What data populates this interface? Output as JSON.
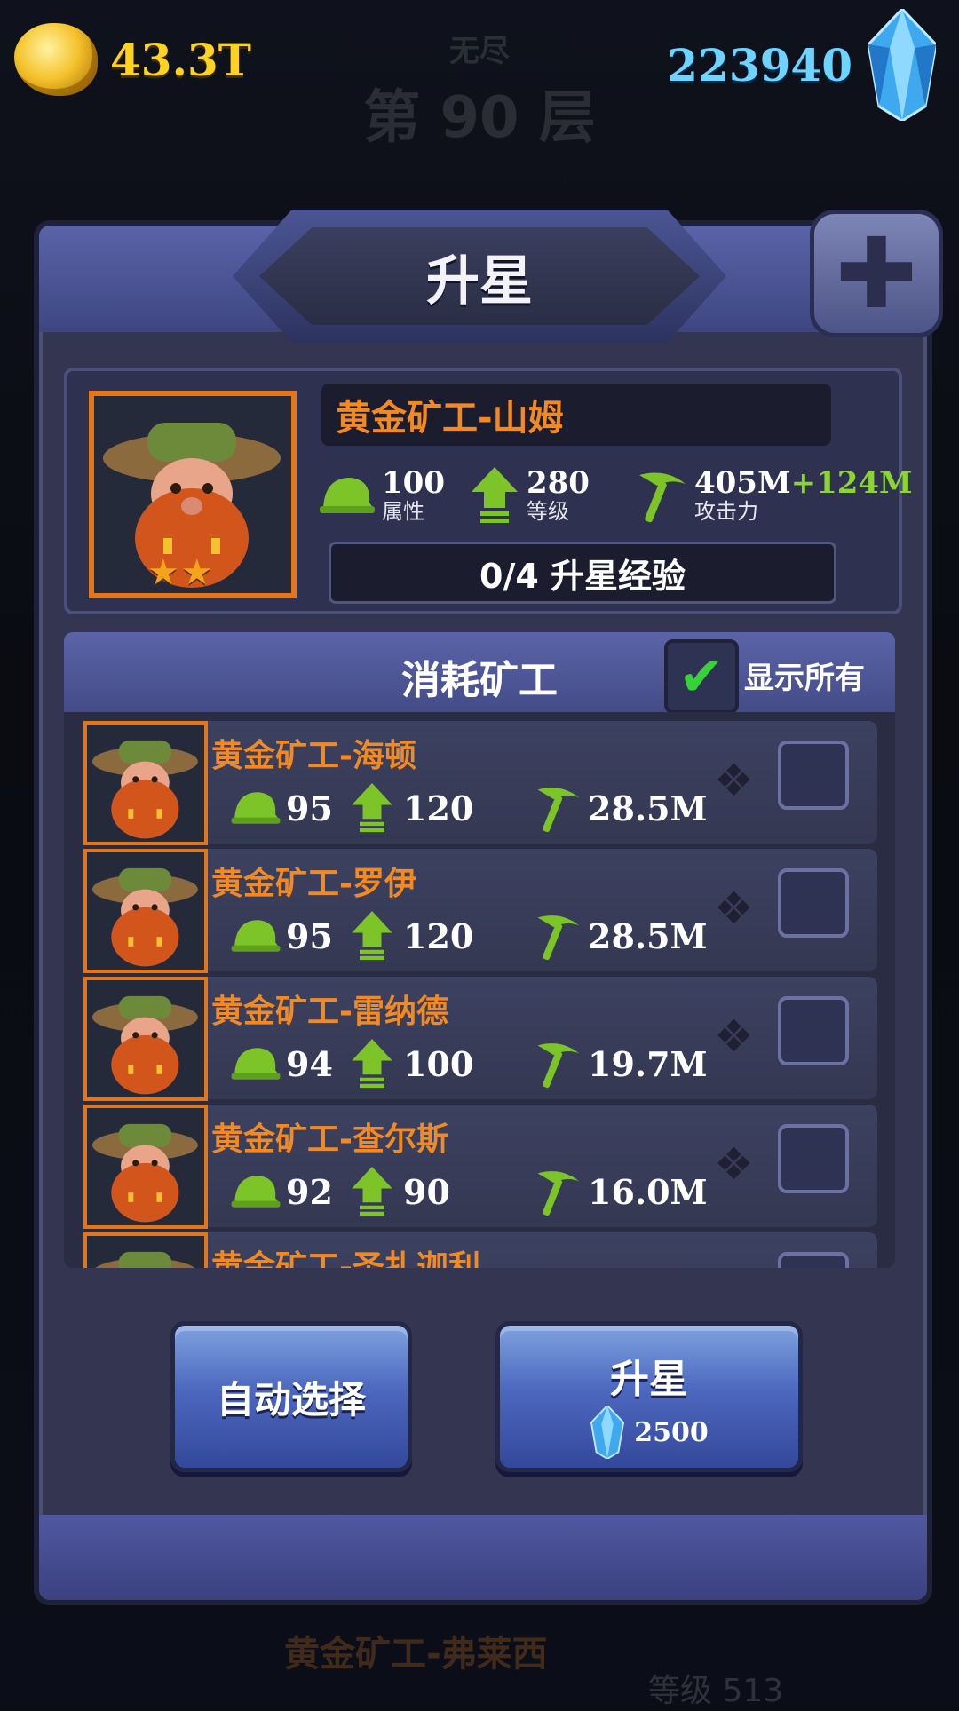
{
  "background": {
    "floor_small": "无尽",
    "floor_big": "第 90 层",
    "bottom_name": "黄金矿工-弗莱西",
    "bottom_level": "等级 513"
  },
  "hud": {
    "gold": "43.3T",
    "gems": "223940",
    "gold_icon": "gold-nugget-icon",
    "gem_icon": "blue-crystal-icon"
  },
  "panel": {
    "title": "升星",
    "close_icon": "close-x-icon"
  },
  "hero": {
    "name": "黄金矿工-山姆",
    "stars": "★★",
    "attribute_value": "100",
    "attribute_label": "属性",
    "level_value": "280",
    "level_label": "等级",
    "attack_value": "405M",
    "attack_bonus": "+124M",
    "attack_label": "攻击力",
    "star_exp": "0/4 升星经验"
  },
  "consume": {
    "title": "消耗矿工",
    "show_all_label": "显示所有",
    "show_all_checked": true,
    "items": [
      {
        "name": "黄金矿工-海顿",
        "attribute": "95",
        "level": "120",
        "attack": "28.5M",
        "selected": false
      },
      {
        "name": "黄金矿工-罗伊",
        "attribute": "95",
        "level": "120",
        "attack": "28.5M",
        "selected": false
      },
      {
        "name": "黄金矿工-雷纳德",
        "attribute": "94",
        "level": "100",
        "attack": "19.7M",
        "selected": false
      },
      {
        "name": "黄金矿工-查尔斯",
        "attribute": "92",
        "level": "90",
        "attack": "16.0M",
        "selected": false
      },
      {
        "name": "黄金矿工-圣扎迦利",
        "attribute": "",
        "level": "",
        "attack": "",
        "selected": false
      }
    ]
  },
  "buttons": {
    "auto_select": "自动选择",
    "upgrade": "升星",
    "upgrade_cost": "2500"
  },
  "colors": {
    "gold_text": "#ffd21f",
    "gem_text": "#6fd3ff",
    "name_orange": "#f28a23",
    "stat_green": "#8bd431",
    "check_green": "#39d13a"
  }
}
